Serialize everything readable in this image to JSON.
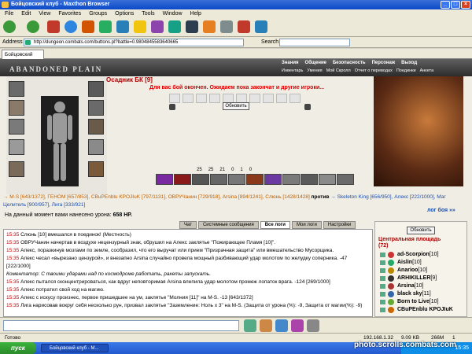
{
  "window": {
    "title": "Бойцовский клуб - Maxthon Browser"
  },
  "menu": [
    "File",
    "Edit",
    "View",
    "Favorites",
    "Groups",
    "Options",
    "Tools",
    "Window",
    "Help"
  ],
  "address": {
    "label": "Address",
    "url": "http://dungeon.combats.com/buttons.pl?battle=0.9804845583640665",
    "search_label": "Search"
  },
  "tabs": [
    {
      "label": "Бойцовский клуб"
    }
  ],
  "game": {
    "location": "ABANDONED PLAIN",
    "nav_top": [
      "Знания",
      "Общение",
      "Безопасность",
      "Персонаж",
      "Выход"
    ],
    "nav_sub": [
      "Инвентарь",
      "Умения",
      "Мой Скролл",
      "Отчет о переводах",
      "Поединки",
      "Анкета"
    ],
    "player": "Осадник БК [9]",
    "status_msg": "Для вас бой окончен. Ожидаем пока закончат и другие игроки...",
    "refresh": "Обновить",
    "stats": [
      "25",
      "25",
      "21",
      "0",
      "1",
      "0"
    ],
    "team1": "→ M-S [643/1372], ГЕНОМ [657/853], CBuPEnblu KPOJIuK [797/1131], ОВРУЧанин [729/918], Arsina [894/1241], Слюнь [1428/1428]",
    "versus": "против",
    "team2": "→ Skeleton King [656/950], Алекс [222/1000], Маг Целитель [900/957], Лига [333/921]",
    "damage_label": "На данный момент вами нанесено урона:",
    "damage_value": "658 HP.",
    "log_link": "лог боя »»"
  },
  "chat_tabs": [
    {
      "label": "Чат"
    },
    {
      "label": "Системные сообщения"
    },
    {
      "label": "Все логи"
    },
    {
      "label": "Мои логи"
    },
    {
      "label": "Настройки"
    }
  ],
  "chat": [
    {
      "time": "15:35",
      "text": "Слюнь [10] вмешался в поединок! (Местность)"
    },
    {
      "time": "15:35",
      "text": "ОВРУЧанин начертав в воздухе нецензурный знак, обрушил на Алекс заклятье \"Пожирающее Пламя [10]\"."
    },
    {
      "time": "15:35",
      "text": "Алекс, поразкинув мозгами по земле, сообразил, что его выручат или прием \"Призрачная защита\" или вмешательство Мусорщика."
    },
    {
      "time": "15:35",
      "text": "Алекс чесал «вырезано цензурой», и внезапно Arsina случайно провела мощный разбивающий удар молотом по желудку соперника. -47 [222/1000]"
    },
    {
      "time": "",
      "text": "Коментатор: С твоими ударами над по космодроме работать, ракеты запускать."
    },
    {
      "time": "15:35",
      "text": "Алекс пытался сконцентрироваться, как вдруг неповторимая Arsina влепила удар молотом промеж лопаток врага. -124 [269/1000]"
    },
    {
      "time": "15:35",
      "text": "Алекс потратил свой ход на магию."
    },
    {
      "time": "15:35",
      "text": "Алекс с искусу произнес, первое пришедшее на ум, заклятье \"Молния [11]\" на M-S. -13 [643/1372]"
    },
    {
      "time": "15:35",
      "text": "Лига нарисовав вокруг себя несколько рун, призвал заклятье \"Заземление: Ноль x 3\" на M-S. (Защита от урона (%): -9, Защита от магии(%): -9)"
    }
  ],
  "room": {
    "refresh": "Обновить",
    "title": "Центральная площадь",
    "count": "(72)",
    "users": [
      {
        "name": "ad-Scorpion",
        "level": "[10]"
      },
      {
        "name": "Aislin",
        "level": "[10]"
      },
      {
        "name": "Anarioo",
        "level": "[10]"
      },
      {
        "name": "ARHIKILLER",
        "level": "[9]"
      },
      {
        "name": "Arsina",
        "level": "[10]"
      },
      {
        "name": "black sky",
        "level": "[11]"
      },
      {
        "name": "Born to Live",
        "level": "[10]"
      },
      {
        "name": "CBuPEnblu KPOJIuK",
        "level": ""
      }
    ]
  },
  "statusbar": {
    "left": "Готово",
    "ip": "192.168.1.32",
    "speed": "9.09 KB",
    "mem": "266M",
    "count": "1"
  },
  "taskbar": {
    "start": "пуск",
    "task": "Бойцовский клуб - M...",
    "clock": "15:35"
  },
  "watermark": "photo.scrolls.combats.com",
  "colors": {
    "titlebar": "#0a49c8",
    "name_red": "#cc0000",
    "name_blue": "#1d4fae"
  }
}
